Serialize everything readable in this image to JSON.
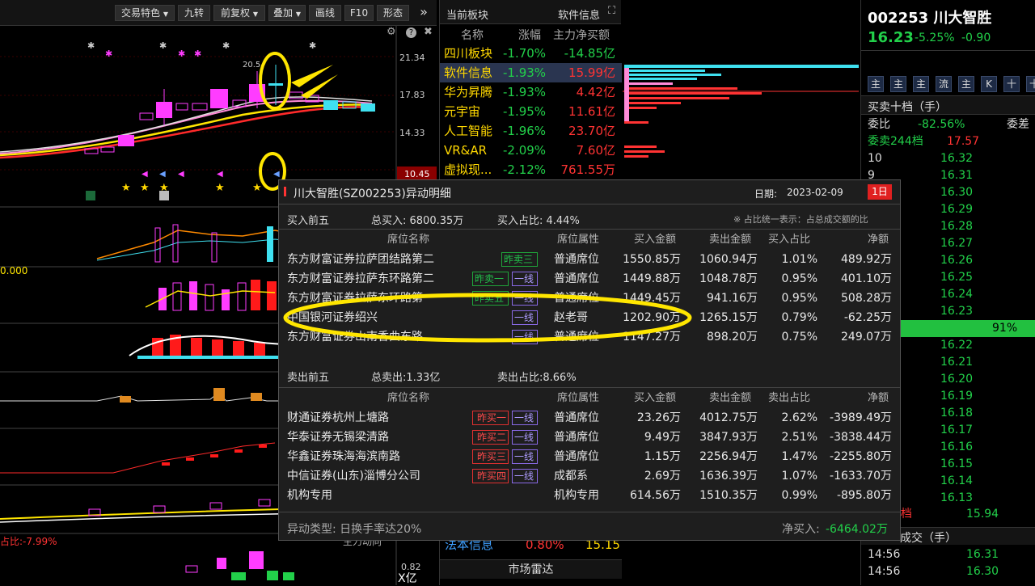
{
  "toolbar": {
    "buttons": [
      "交易特色",
      "九转",
      "前复权",
      "叠加",
      "画线",
      "F10",
      "形态"
    ],
    "more": "»"
  },
  "chart": {
    "price_ticks": [
      "21.34",
      "17.83",
      "14.33",
      "10.45"
    ],
    "peak_label": "20.5",
    "indicator_label_1": "0.000",
    "indicator_label_2": "占比:-7.99%",
    "bottom_label": "主力动向",
    "bottom_ticks": [
      "0.82",
      "X亿"
    ]
  },
  "board": {
    "title": "当前板块",
    "title_right": "软件信息",
    "columns": [
      "名称",
      "涨幅",
      "主力净买额"
    ],
    "rows": [
      {
        "name": "四川板块",
        "change": "-1.70%",
        "net": "-14.85亿",
        "net_dir": "down"
      },
      {
        "name": "软件信息",
        "change": "-1.93%",
        "net": "15.99亿",
        "net_dir": "up"
      },
      {
        "name": "华为昇腾",
        "change": "-1.93%",
        "net": "4.42亿",
        "net_dir": "up"
      },
      {
        "name": "元宇宙",
        "change": "-1.95%",
        "net": "11.61亿",
        "net_dir": "up"
      },
      {
        "name": "人工智能",
        "change": "-1.96%",
        "net": "23.70亿",
        "net_dir": "up"
      },
      {
        "name": "VR&AR",
        "change": "-2.09%",
        "net": "7.60亿",
        "net_dir": "up"
      },
      {
        "name": "虚拟现...",
        "change": "-2.12%",
        "net": "761.55万",
        "net_dir": "up"
      }
    ],
    "bottom": {
      "name": "法本信息",
      "change": "0.80%",
      "price": "15.15"
    },
    "radar": "市场雷达"
  },
  "stock": {
    "code": "002253",
    "name": "川大智胜",
    "price": "16.23",
    "change_pct": "-5.25%",
    "change": "-0.90",
    "quick_buttons": [
      "主",
      "主",
      "主",
      "流",
      "主",
      "K",
      "十",
      "十"
    ],
    "orderbook_title": "买卖十档（手）",
    "wei_bi_label": "委比",
    "wei_bi": "-82.56%",
    "wei_cha_label": "委差",
    "sell_total": "委卖244档",
    "sell_total_price": "17.57",
    "sell_levels": [
      {
        "level": "10",
        "price": "16.32"
      },
      {
        "level": "9",
        "price": "16.31"
      },
      {
        "level": "",
        "price": "16.30"
      },
      {
        "level": "",
        "price": "16.29"
      },
      {
        "level": "",
        "price": "16.28"
      },
      {
        "level": "",
        "price": "16.27"
      },
      {
        "level": "",
        "price": "16.26"
      },
      {
        "level": "",
        "price": "16.25"
      },
      {
        "level": "",
        "price": "16.24"
      },
      {
        "level": "",
        "price": "16.23"
      }
    ],
    "ratio_bar": "91%",
    "buy_levels": [
      "16.22",
      "16.21",
      "16.20",
      "16.19",
      "16.18",
      "16.17",
      "16.16",
      "16.15",
      "16.14",
      "16.13"
    ],
    "buy_total": "0档",
    "buy_total_price": "15.94",
    "trades_title": "成交（手）",
    "trades": [
      {
        "time": "14:56",
        "price": "16.31"
      },
      {
        "time": "14:56",
        "price": "16.30"
      }
    ]
  },
  "popup": {
    "title": "川大智胜(SZ002253)异动明细",
    "date_label": "日期:",
    "date": "2023-02-09",
    "period": "1日",
    "buy_section": "买入前五",
    "buy_total_label": "总买入: 6800.35万",
    "buy_ratio_label": "买入占比: 4.44%",
    "note": "※ 占比统一表示：占总成交额的比",
    "columns": [
      "席位名称",
      "席位属性",
      "买入金额",
      "卖出金额",
      "买入占比",
      "净额"
    ],
    "buy_rows": [
      {
        "name": "东方财富证券拉萨团结路第二",
        "tags": [
          {
            "text": "昨卖三",
            "c": "g"
          }
        ],
        "attr": "普通席位",
        "buy": "1550.85万",
        "sell": "1060.94万",
        "ratio": "1.01%",
        "net": "489.92万"
      },
      {
        "name": "东方财富证券拉萨东环路第二",
        "tags": [
          {
            "text": "昨卖一",
            "c": "g"
          },
          {
            "text": "一线",
            "c": "p"
          }
        ],
        "attr": "普通席位",
        "buy": "1449.88万",
        "sell": "1048.78万",
        "ratio": "0.95%",
        "net": "401.10万"
      },
      {
        "name": "东方财富证券拉萨东环路第",
        "tags": [
          {
            "text": "昨卖五",
            "c": "g"
          },
          {
            "text": "一线",
            "c": "p"
          }
        ],
        "attr": "普通席位",
        "buy": "1449.45万",
        "sell": "941.16万",
        "ratio": "0.95%",
        "net": "508.28万"
      },
      {
        "name": "中国银河证券绍兴",
        "tags": [
          {
            "text": "一线",
            "c": "p"
          }
        ],
        "attr": "赵老哥",
        "buy": "1202.90万",
        "sell": "1265.15万",
        "ratio": "0.79%",
        "net": "-62.25万"
      },
      {
        "name": "东方财富证券山南香曲东路",
        "tags": [
          {
            "text": "一线",
            "c": "p"
          }
        ],
        "attr": "普通席位",
        "buy": "1147.27万",
        "sell": "898.20万",
        "ratio": "0.75%",
        "net": "249.07万"
      }
    ],
    "sell_section": "卖出前五",
    "sell_total_label": "总卖出:1.33亿",
    "sell_ratio_label": "卖出占比:8.66%",
    "sell_columns": [
      "席位名称",
      "席位属性",
      "买入金额",
      "卖出金额",
      "卖出占比",
      "净额"
    ],
    "sell_rows": [
      {
        "name": "财通证券杭州上塘路",
        "tags": [
          {
            "text": "昨买一",
            "c": "r"
          },
          {
            "text": "一线",
            "c": "p"
          }
        ],
        "attr": "普通席位",
        "buy": "23.26万",
        "sell": "4012.75万",
        "ratio": "2.62%",
        "net": "-3989.49万"
      },
      {
        "name": "华泰证券无锡梁清路",
        "tags": [
          {
            "text": "昨买二",
            "c": "r"
          },
          {
            "text": "一线",
            "c": "p"
          }
        ],
        "attr": "普通席位",
        "buy": "9.49万",
        "sell": "3847.93万",
        "ratio": "2.51%",
        "net": "-3838.44万"
      },
      {
        "name": "华鑫证券珠海海滨南路",
        "tags": [
          {
            "text": "昨买三",
            "c": "r"
          },
          {
            "text": "一线",
            "c": "p"
          }
        ],
        "attr": "普通席位",
        "buy": "1.15万",
        "sell": "2256.94万",
        "ratio": "1.47%",
        "net": "-2255.80万"
      },
      {
        "name": "中信证券(山东)淄博分公司",
        "tags": [
          {
            "text": "昨买四",
            "c": "r"
          },
          {
            "text": "一线",
            "c": "p"
          }
        ],
        "attr": "成都系",
        "buy": "2.69万",
        "sell": "1636.39万",
        "ratio": "1.07%",
        "net": "-1633.70万"
      },
      {
        "name": "机构专用",
        "tags": [],
        "attr": "机构专用",
        "buy": "614.56万",
        "sell": "1510.35万",
        "ratio": "0.99%",
        "net": "-895.80万"
      }
    ],
    "footer_type": "异动类型: 日换手率达20%",
    "footer_net_label": "净买入:",
    "footer_net": "-6464.02万"
  }
}
